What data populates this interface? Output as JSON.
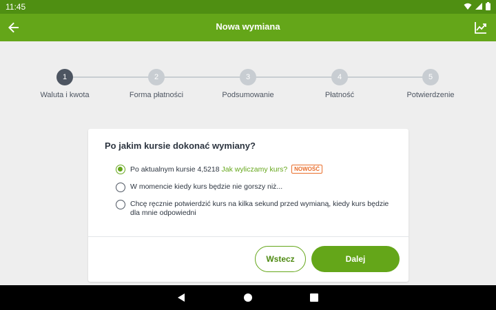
{
  "status_bar": {
    "time": "11:45"
  },
  "app_bar": {
    "title": "Nowa wymiana"
  },
  "stepper": {
    "steps": [
      {
        "number": "1",
        "label": "Waluta i kwota",
        "active": true
      },
      {
        "number": "2",
        "label": "Forma płatności",
        "active": false
      },
      {
        "number": "3",
        "label": "Podsumowanie",
        "active": false
      },
      {
        "number": "4",
        "label": "Płatność",
        "active": false
      },
      {
        "number": "5",
        "label": "Potwierdzenie",
        "active": false
      }
    ]
  },
  "card": {
    "question": "Po jakim kursie dokonać wymiany?",
    "options": [
      {
        "text": "Po aktualnym kursie 4,5218",
        "link": "Jak wyliczamy kurs?",
        "badge": "NOWOŚĆ",
        "selected": true
      },
      {
        "text": "W momencie kiedy kurs będzie nie gorszy niż...",
        "selected": false
      },
      {
        "text": "Chcę ręcznie potwierdzić kurs na kilka sekund przed wymianą, kiedy kurs będzie dla mnie odpowiedni",
        "selected": false
      }
    ],
    "back_button": "Wstecz",
    "next_button": "Dalej"
  },
  "colors": {
    "primary": "#64a619",
    "status_bar": "#4f8f12",
    "badge": "#e96d2a",
    "active_step": "#4d5561"
  }
}
